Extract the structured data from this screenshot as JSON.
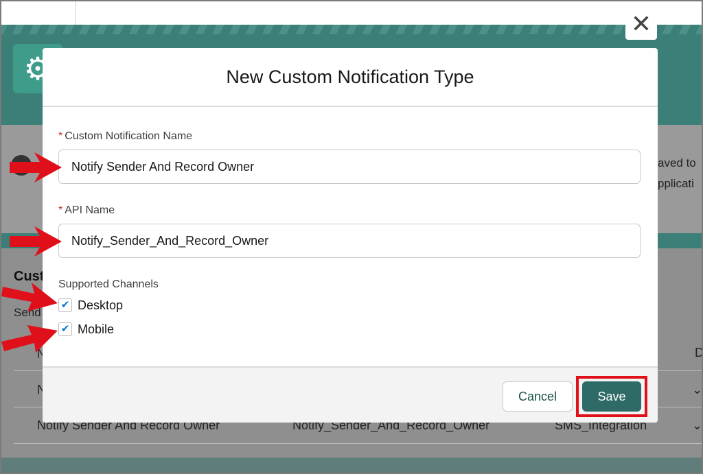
{
  "modal": {
    "title": "New Custom Notification Type",
    "close_icon": "close-icon",
    "fields": {
      "name": {
        "required_mark": "*",
        "label": "Custom Notification Name",
        "value": "Notify Sender And Record Owner"
      },
      "api_name": {
        "required_mark": "*",
        "label": "API Name",
        "value": "Notify_Sender_And_Record_Owner"
      }
    },
    "channels": {
      "label": "Supported Channels",
      "desktop": {
        "label": "Desktop",
        "checked": true
      },
      "mobile": {
        "label": "Mobile",
        "checked": true
      },
      "check_icon": "✔"
    },
    "footer": {
      "cancel_label": "Cancel",
      "save_label": "Save"
    }
  },
  "background": {
    "info_text_line1": "aved to",
    "info_text_line2": "pplicati",
    "section_title": "Cust",
    "section_sub": "Send",
    "table_header_partial": "N",
    "table_header_right": "D",
    "row1_partial": "N",
    "row2": {
      "name": "Notify Sender And Record Owner",
      "api_name": "Notify_Sender_And_Record_Owner",
      "channel": "SMS_Integration"
    }
  },
  "colors": {
    "accent_teal": "#2e6b66",
    "annotation_red": "#e0101a",
    "checkbox_blue": "#0176d3"
  }
}
